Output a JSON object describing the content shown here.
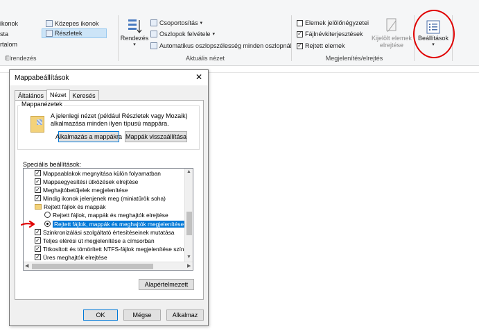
{
  "ribbon": {
    "layout": {
      "items": [
        "ikonok",
        "Közepes ikonok",
        "sta",
        "Részletek",
        "rtalom"
      ],
      "group_label": "Elrendezés"
    },
    "current_view": {
      "sort_label": "Rendezés",
      "group_by": "Csoportosítás",
      "add_columns": "Oszlopok felvétele",
      "autofit": "Automatikus oszlopszélesség minden oszlopnál",
      "group_label": "Aktuális nézet"
    },
    "show_hide": {
      "item_checkboxes": "Elemek jelölőnégyzetei",
      "file_extensions": "Fájlnévkiterjesztések",
      "hidden_items": "Rejtett elemek",
      "hide_selected_line1": "Kijelölt elemek",
      "hide_selected_line2": "elrejtése",
      "group_label": "Megjelenítés/elrejtés"
    },
    "options_label": "Beállítások"
  },
  "dialog": {
    "title": "Mappabeállítások",
    "close_glyph": "✕",
    "tabs": [
      "Általános",
      "Nézet",
      "Keresés"
    ],
    "active_tab": "Nézet",
    "folder_views": {
      "legend": "Mappanézetek",
      "description": "A jelenlegi nézet (például Részletek vagy Mozaik) alkalmazása minden ilyen típusú mappára.",
      "apply_button": "Alkalmazás a mappákra",
      "reset_button": "Mappák visszaállítása"
    },
    "advanced_label": "Speciális beállítások:",
    "advanced_items": [
      {
        "kind": "checkbox",
        "checked": true,
        "text": "Mappaablakok megnyitása külön folyamatban"
      },
      {
        "kind": "checkbox",
        "checked": true,
        "text": "Mappaegyesítési ütközések elrejtése"
      },
      {
        "kind": "checkbox",
        "checked": true,
        "text": "Meghajtóbetűjelek megjelenítése"
      },
      {
        "kind": "checkbox",
        "checked": true,
        "text": "Mindig ikonok jelenjenek meg (miniatűrök soha)"
      },
      {
        "kind": "folder",
        "text": "Rejtett fájlok és mappák"
      },
      {
        "kind": "radio",
        "checked": false,
        "text": "Rejtett fájlok, mappák és meghajtók elrejtése"
      },
      {
        "kind": "radio",
        "checked": true,
        "text": "Rejtett fájlok, mappák és meghajtók megjelenítése"
      },
      {
        "kind": "checkbox",
        "checked": true,
        "text": "Szinkronizálási szolgáltató értesítéseinek mutatása"
      },
      {
        "kind": "checkbox",
        "checked": true,
        "text": "Teljes elérési út megjelenítése a címsorban"
      },
      {
        "kind": "checkbox",
        "checked": true,
        "text": "Titkosított és tömörített NTFS-fájlok megjelenítése színe"
      },
      {
        "kind": "checkbox",
        "checked": true,
        "text": "Üres meghajtók elrejtése"
      }
    ],
    "defaults_button": "Alapértelmezett",
    "ok_button": "OK",
    "cancel_button": "Mégse",
    "apply_button": "Alkalmaz"
  },
  "colors": {
    "annotation_red": "#e00000",
    "selection_blue": "#0078d7"
  }
}
